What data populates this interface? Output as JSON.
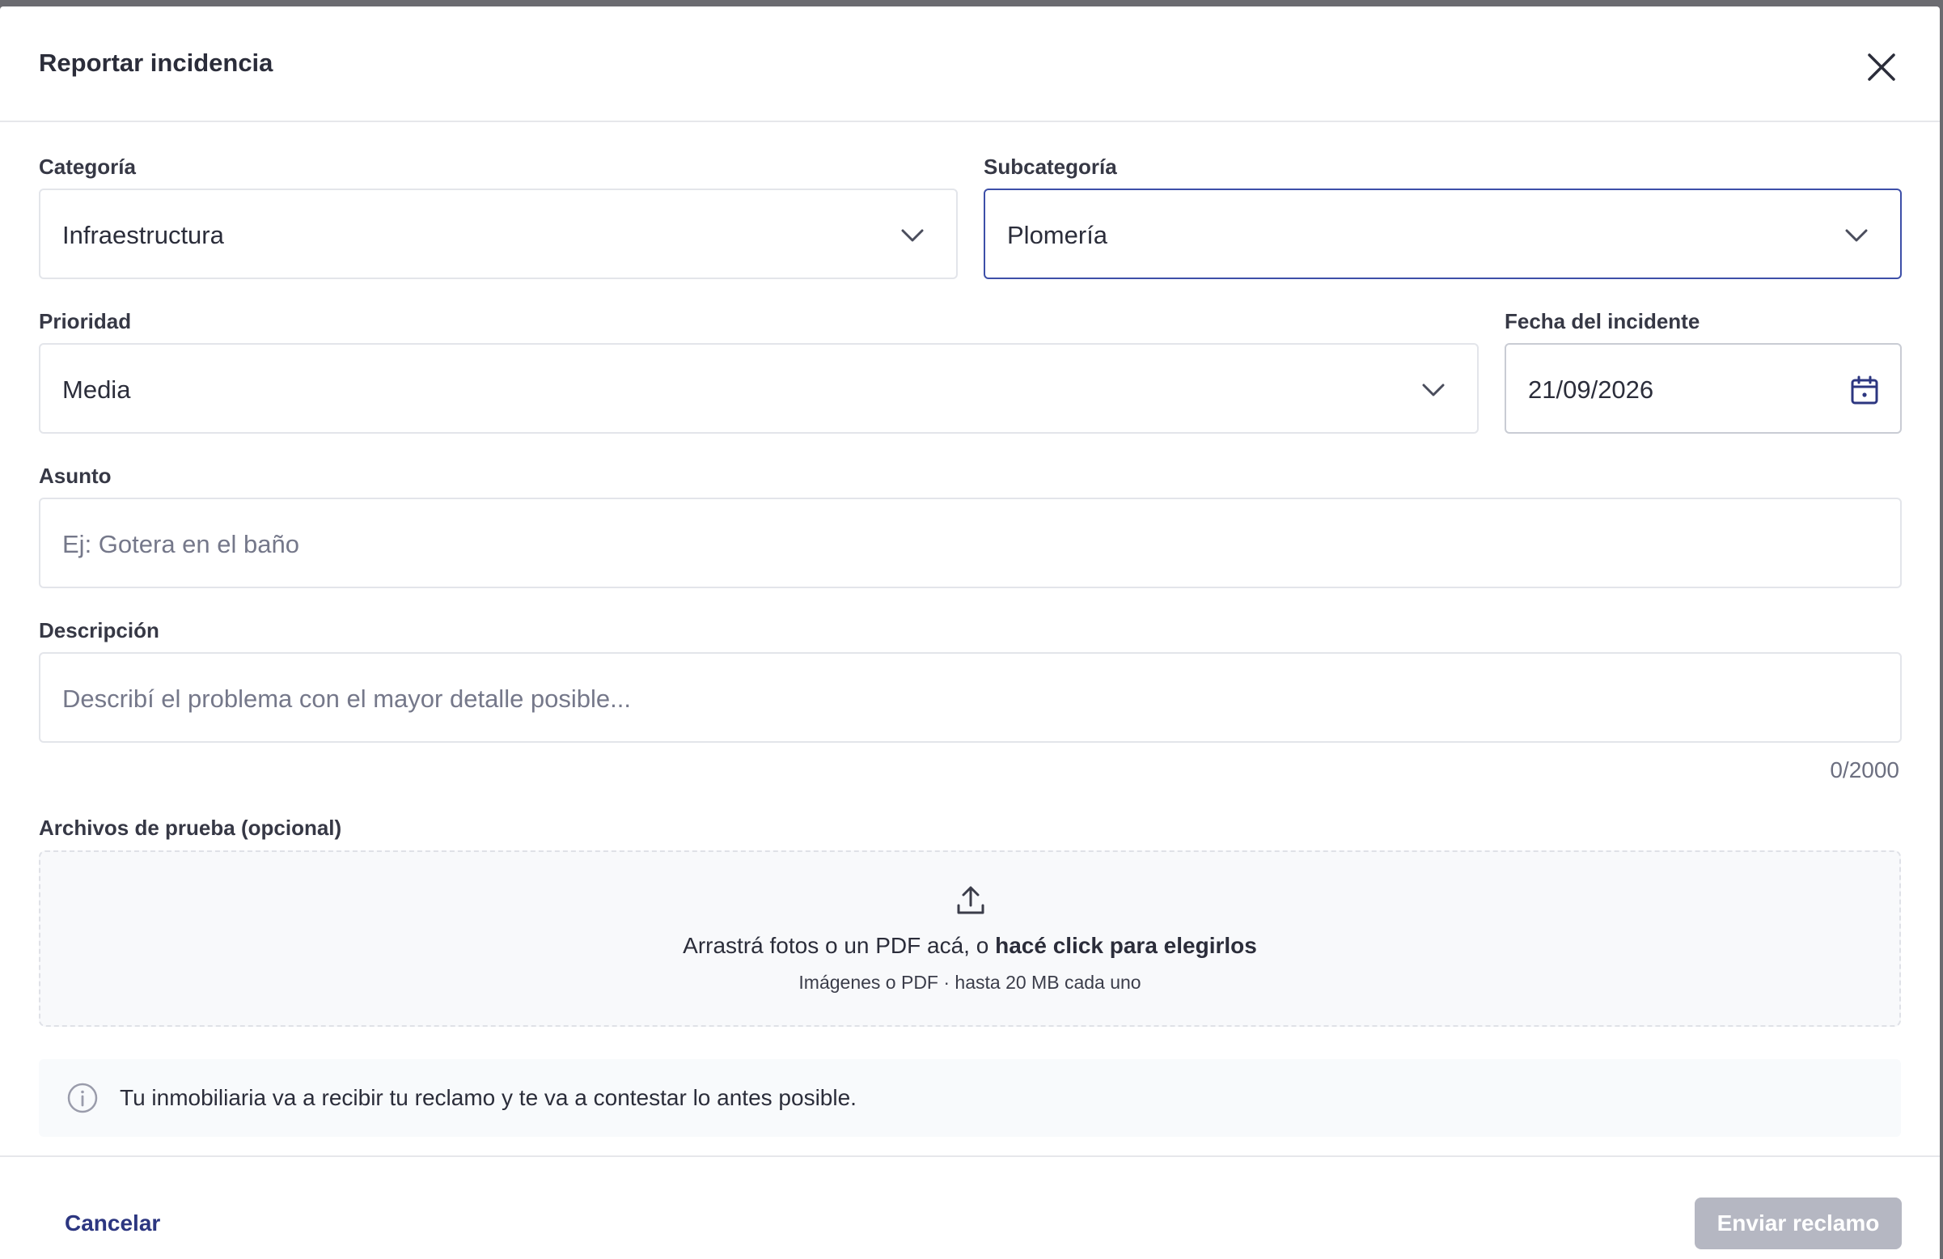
{
  "dialog": {
    "title": "Reportar incidencia"
  },
  "form": {
    "category": {
      "label": "Categoría",
      "value": "Infraestructura"
    },
    "subcategory": {
      "label": "Subcategoría",
      "value": "Plomería"
    },
    "priority": {
      "label": "Prioridad",
      "value": "Media"
    },
    "incident_date": {
      "label": "Fecha del incidente",
      "value": "21/09/2026"
    },
    "subject": {
      "label": "Asunto",
      "placeholder": "Ej: Gotera en el baño"
    },
    "description": {
      "label": "Descripción",
      "placeholder": "Describí el problema con el mayor detalle posible...",
      "counter": "0/2000"
    },
    "attachments": {
      "label": "Archivos de prueba (opcional)",
      "drop_text": "Arrastrá fotos o un PDF acá, o ",
      "drop_link": "hacé click para elegirlos",
      "hint": "Imágenes o PDF · hasta 20 MB cada uno"
    },
    "notice": "Tu inmobiliaria va a recibir tu reclamo y te va a contestar lo antes posible."
  },
  "footer": {
    "cancel_label": "Cancelar",
    "submit_label": "Enviar reclamo"
  },
  "colors": {
    "accent": "#2c3680",
    "focus_border": "#3d4fa8",
    "disabled_button": "#b5b7c2"
  },
  "icons": {
    "close": "close-icon",
    "dropdown": "chevron-down-icon",
    "date": "calendar-icon",
    "upload": "upload-icon",
    "info": "info-icon"
  }
}
